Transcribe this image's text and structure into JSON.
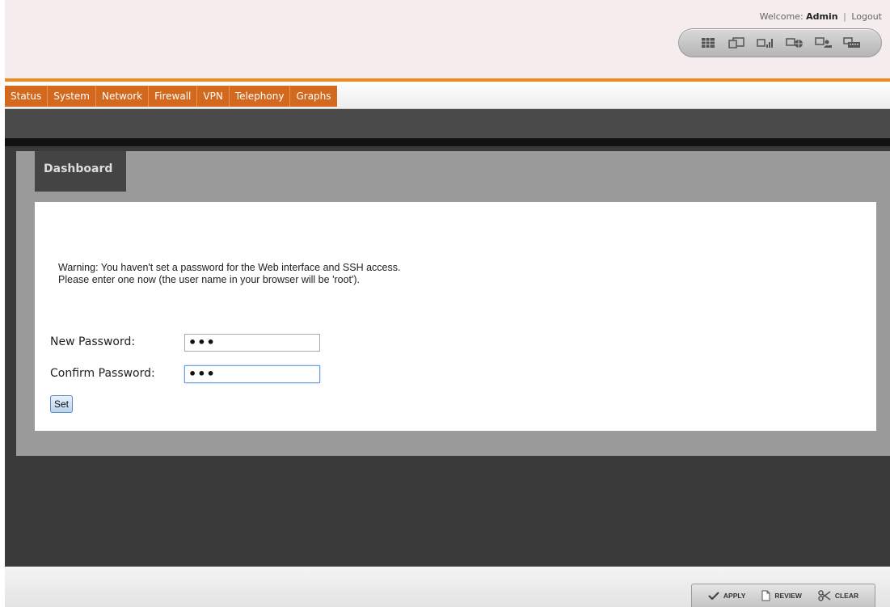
{
  "header": {
    "welcome_prefix": "Welcome:",
    "user": "Admin",
    "separator": "|",
    "logout": "Logout",
    "toolbar_icons": [
      "grid-icon",
      "window-icon",
      "signal-icon",
      "network-globe-icon",
      "users-icon",
      "keyboard-icon"
    ]
  },
  "nav": {
    "tabs": [
      "Status",
      "System",
      "Network",
      "Firewall",
      "VPN",
      "Telephony",
      "Graphs"
    ]
  },
  "dashboard": {
    "tab_label": "Dashboard",
    "warning_line1": "Warning: You haven't set a password for the Web interface and SSH access.",
    "warning_line2": "Please enter one now (the user name in your browser will be 'root').",
    "new_password_label": "New Password:",
    "new_password_value": "•••",
    "confirm_password_label": "Confirm Password:",
    "confirm_password_value": "•••",
    "set_button": "Set"
  },
  "footer": {
    "apply": "APPLY",
    "review": "REVIEW",
    "clear": "CLEAR"
  },
  "colors": {
    "accent": "#f08a1c",
    "nav_bg": "#d2691e",
    "header_bg": "#f5eded",
    "panel_bg": "#9a9a9a",
    "content_bg": "#3a3a3a"
  }
}
